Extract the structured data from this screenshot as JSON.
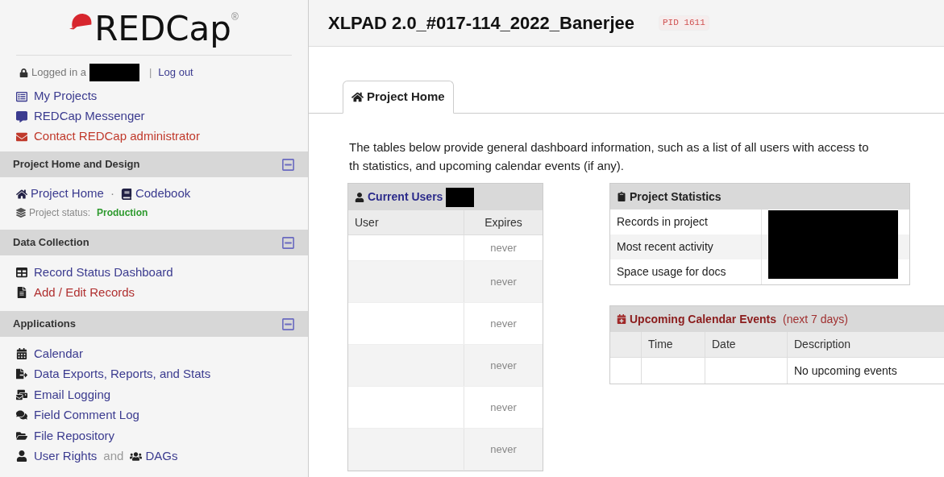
{
  "logo": {
    "text": "REDCap",
    "mark": "®"
  },
  "login": {
    "prefix": "Logged in a",
    "separator": "|",
    "logout": "Log out"
  },
  "top_links": [
    {
      "label": "My Projects",
      "color": "#3b3b8f"
    },
    {
      "label": "REDCap Messenger",
      "color": "#3b3b8f"
    },
    {
      "label": "Contact REDCap administrator",
      "color": "#c0392b"
    }
  ],
  "sections": [
    {
      "title": "Project Home and Design",
      "expanded": true,
      "links": [
        {
          "label": "Project Home",
          "color": "#3b3b8f"
        },
        {
          "label": "Codebook",
          "color": "#3b3b8f"
        }
      ],
      "link_separator": "·",
      "status_label": "Project status:",
      "status_value": "Production"
    },
    {
      "title": "Data Collection",
      "expanded": true,
      "items": [
        {
          "label": "Record Status Dashboard",
          "color": "#3b3b8f"
        },
        {
          "label": "Add / Edit Records",
          "color": "#b03030"
        }
      ]
    },
    {
      "title": "Applications",
      "expanded": true,
      "items": [
        {
          "label": "Calendar",
          "color": "#3b3b8f"
        },
        {
          "label": "Data Exports, Reports, and Stats",
          "color": "#3b3b8f"
        },
        {
          "label": "Email Logging",
          "color": "#3b3b8f"
        },
        {
          "label": "Field Comment Log",
          "color": "#3b3b8f"
        },
        {
          "label": "File Repository",
          "color": "#3b3b8f"
        },
        {
          "label": "User Rights",
          "color": "#3b3b8f",
          "joiner": "and",
          "extra": "DAGs"
        }
      ]
    }
  ],
  "project": {
    "title": "XLPAD 2.0_#017-114_2022_Banerjee",
    "pid": "PID 1611"
  },
  "tabs": [
    {
      "label": "Project Home",
      "selected": true
    }
  ],
  "intro": "The tables below provide general dashboard information, such as a list of all users with access to th statistics, and upcoming calendar events (if any).",
  "current_users": {
    "title": "Current Users",
    "columns": [
      "User",
      "Expires"
    ],
    "rows": [
      {
        "expires": "never"
      },
      {
        "expires": "never"
      },
      {
        "expires": "never"
      },
      {
        "expires": "never"
      },
      {
        "expires": "never"
      },
      {
        "expires": "never"
      }
    ]
  },
  "project_statistics": {
    "title": "Project Statistics",
    "rows": [
      "Records in project",
      "Most recent activity",
      "Space usage for docs"
    ]
  },
  "calendar": {
    "title": "Upcoming Calendar Events",
    "subtitle": "(next 7 days)",
    "columns": [
      "Time",
      "Date",
      "Description"
    ],
    "empty": "No upcoming events"
  }
}
